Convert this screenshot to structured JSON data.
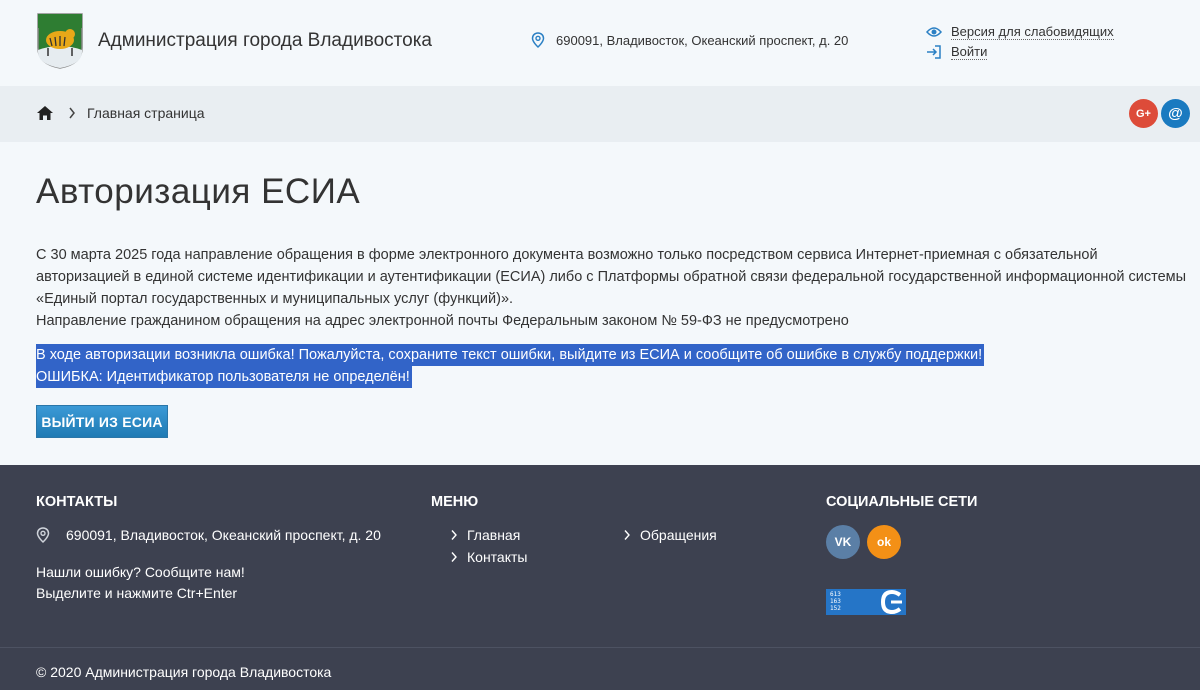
{
  "header": {
    "site_title": "Администрация города Владивостока",
    "address": "690091, Владивосток, Океанский проспект, д. 20",
    "low_vision_link": "Версия для слабовидящих",
    "login_link": "Войти",
    "logo_icon": "vladivostok-coat-of-arms-icon"
  },
  "breadcrumb": {
    "current": "Главная страница",
    "social": [
      {
        "name": "google-plus",
        "glyph": "G+"
      },
      {
        "name": "email",
        "glyph": "@"
      }
    ]
  },
  "main": {
    "title": "Авторизация ЕСИА",
    "paragraph_lines": [
      "С 30 марта 2025 года направление обращения в форме электронного документа возможно только посредством сервиса Интернет-приемная  с обязательной",
      "авторизацией в единой системе идентификации и аутентификации (ЕСИА) либо с  Платформы обратной связи  федеральной государственной информационной системы",
      "«Единый портал государственных и муниципальных услуг (функций)».",
      "Направление гражданином обращения на адрес электронной почты Федеральным законом № 59-ФЗ не предусмотрено"
    ],
    "error_lines": [
      "В ходе авторизации возникла ошибка! Пожалуйста, сохраните текст ошибки, выйдите из ЕСИА и сообщите об ошибке в службу поддержки!",
      "ОШИБКА: Идентификатор пользователя не определён!"
    ],
    "exit_button": "ВЫЙТИ ИЗ ЕСИА"
  },
  "footer": {
    "contacts_heading": "КОНТАКТЫ",
    "menu_heading": "МЕНЮ",
    "social_heading": "СОЦИАЛЬНЫЕ СЕТИ",
    "address": "690091, Владивосток, Океанский проспект, д. 20",
    "note_line1": "Нашли ошибку? Сообщите нам!",
    "note_line2": "Выделите и нажмите Ctr+Enter",
    "menu_items": [
      "Главная",
      "Контакты",
      "Обращения"
    ],
    "social": [
      {
        "name": "vk",
        "glyph": "VK"
      },
      {
        "name": "odnoklassniki",
        "glyph": "ok"
      }
    ],
    "counter_values": [
      "613",
      "163",
      "152"
    ],
    "copyright": "© 2020 Администрация города Владивостока"
  },
  "colors": {
    "page_bg": "#f4f8fb",
    "crumb_bg": "#e9eef2",
    "footer_bg": "#3d4150",
    "accent": "#1f7bb4",
    "selection": "#3264c8"
  }
}
